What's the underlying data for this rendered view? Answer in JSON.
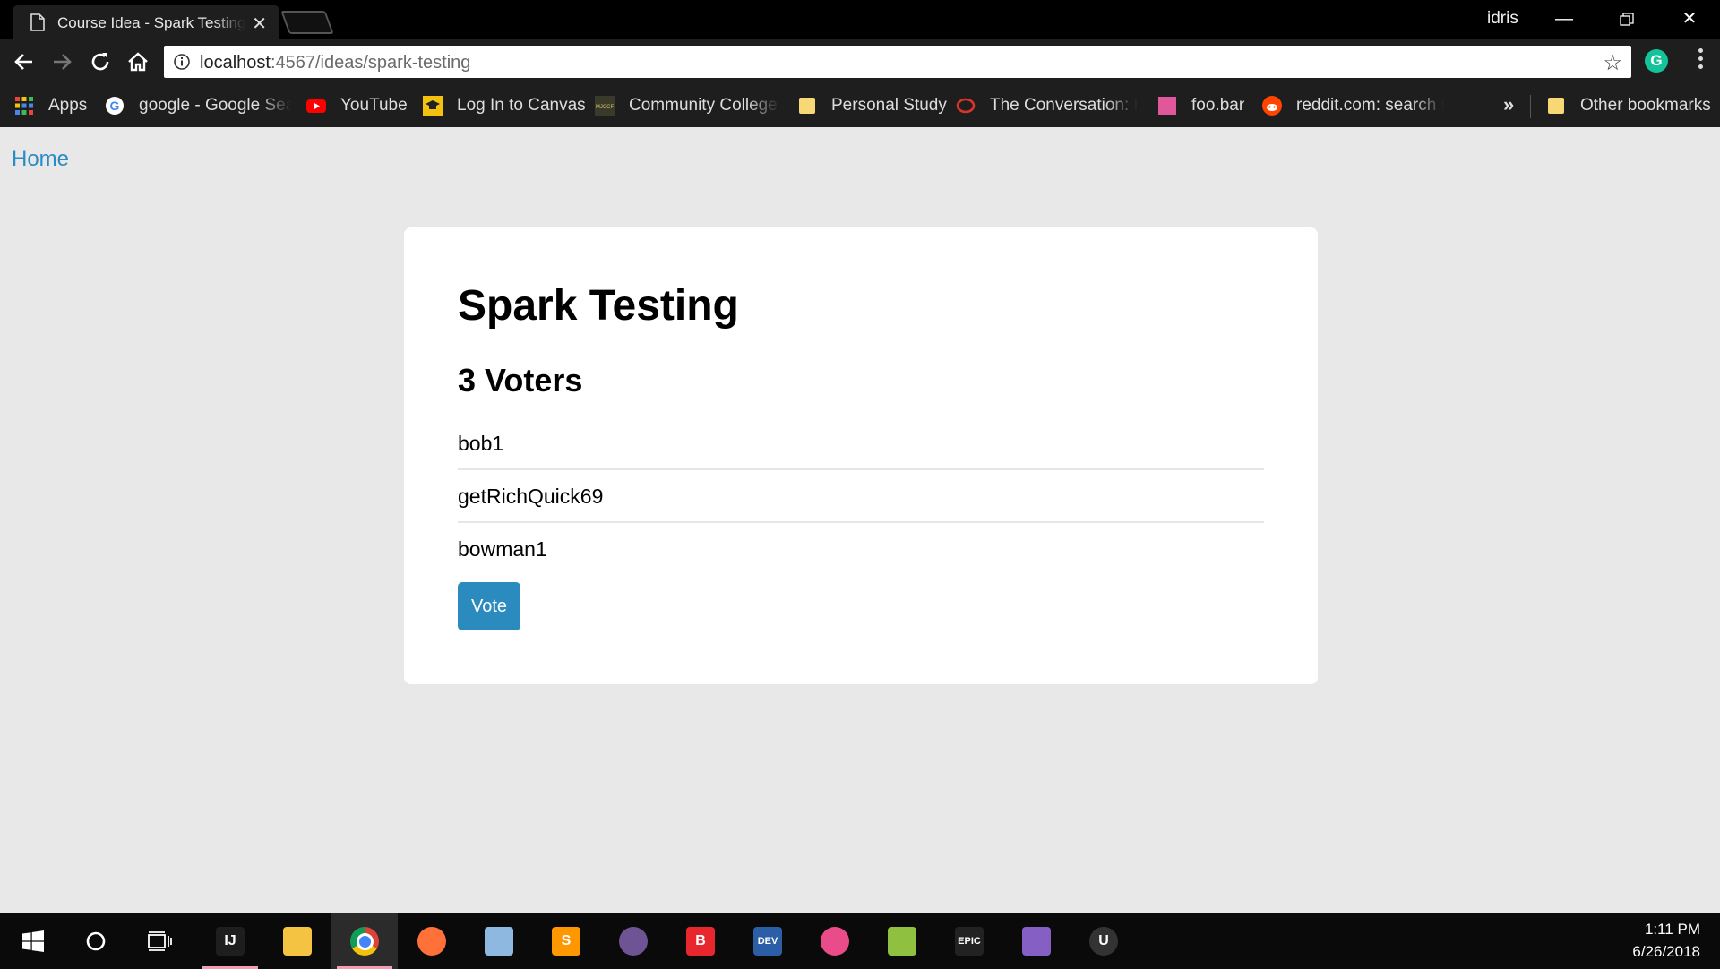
{
  "browser": {
    "tab_title": "Course Idea - Spark Testing",
    "profile_name": "idris",
    "url_host": "localhost",
    "url_path": ":4567/ideas/spark-testing"
  },
  "bookmarks": [
    {
      "label": "Apps",
      "icon": "apps-grid-icon",
      "color": "#e8453c"
    },
    {
      "label": "google - Google Search",
      "icon": "google-icon",
      "color": "#4285f4"
    },
    {
      "label": "YouTube",
      "icon": "youtube-icon",
      "color": "#ff0000"
    },
    {
      "label": "Log In to Canvas",
      "icon": "canvas-icon",
      "color": "#f4c20d"
    },
    {
      "label": "Community College",
      "icon": "mjccf-icon",
      "color": "#b8a04a"
    },
    {
      "label": "Personal Study",
      "icon": "folder-icon",
      "color": "#f8d775"
    },
    {
      "label": "The Conversation: In",
      "icon": "conversation-icon",
      "color": "#d8352a"
    },
    {
      "label": "foo.bar",
      "icon": "foobar-icon",
      "color": "#e0579b"
    },
    {
      "label": "reddit.com: search re",
      "icon": "reddit-icon",
      "color": "#ff4500"
    },
    {
      "label": "Other bookmarks",
      "icon": "folder-icon",
      "color": "#f8d775"
    }
  ],
  "bookmarks_more": "»",
  "page": {
    "home_link": "Home",
    "idea_title": "Spark Testing",
    "voters_heading": "3 Voters",
    "voters": [
      "bob1",
      "getRichQuick69",
      "bowman1"
    ],
    "vote_button": "Vote"
  },
  "taskbar": {
    "time": "1:11 PM",
    "date": "6/26/2018",
    "apps": [
      {
        "name": "intellij-icon",
        "label": "IJ",
        "color": "#1e1e1e"
      },
      {
        "name": "file-explorer-icon",
        "label": "",
        "color": "#f5c342"
      },
      {
        "name": "chrome-icon",
        "label": "",
        "color": "#4285f4"
      },
      {
        "name": "firefox-icon",
        "label": "",
        "color": "#ff7139"
      },
      {
        "name": "virtualbox-icon",
        "label": "",
        "color": "#8fb8e0"
      },
      {
        "name": "sublime-icon",
        "label": "S",
        "color": "#ff9800"
      },
      {
        "name": "github-icon",
        "label": "",
        "color": "#6e5494"
      },
      {
        "name": "brave-b-icon",
        "label": "B",
        "color": "#e8262d"
      },
      {
        "name": "devcpp-icon",
        "label": "DEV",
        "color": "#2c5ea8"
      },
      {
        "name": "itunes-icon",
        "label": "",
        "color": "#ea4c89"
      },
      {
        "name": "notepadpp-icon",
        "label": "",
        "color": "#90c040"
      },
      {
        "name": "epic-games-icon",
        "label": "EPIC",
        "color": "#222222"
      },
      {
        "name": "visual-studio-icon",
        "label": "",
        "color": "#865fc5"
      },
      {
        "name": "unreal-icon",
        "label": "U",
        "color": "#333333"
      }
    ]
  },
  "colors": {
    "accent": "#2a8cc4",
    "button": "#2b8bbf",
    "page_bg": "#e8e8e8"
  }
}
